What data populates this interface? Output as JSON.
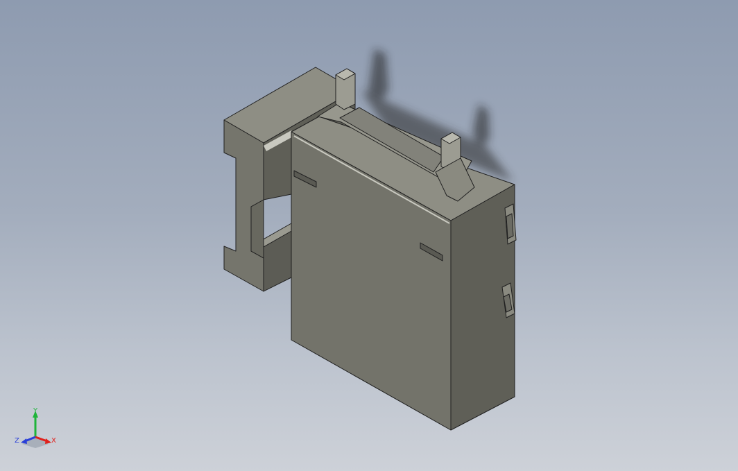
{
  "triad": {
    "x_label": "X",
    "y_label": "Y",
    "z_label": "Z",
    "x_color": "#e0201b",
    "y_color": "#1fb43a",
    "z_color": "#2a3fd8"
  },
  "model": {
    "face_front_color": "#73736a",
    "face_top_color": "#8e8e84",
    "face_side_color": "#5f5f57",
    "edge_color": "#202020",
    "highlight_color": "#c9c9c0",
    "shadow_color": "#1a1a1a"
  }
}
